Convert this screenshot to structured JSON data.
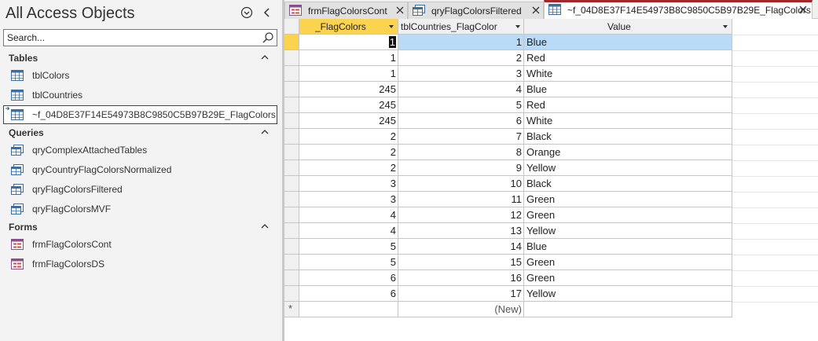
{
  "nav": {
    "title": "All Access Objects",
    "menu_icon": "circle-chevron-down-icon",
    "collapse_icon": "chevron-left-icon",
    "search_placeholder": "Search...",
    "groups": [
      {
        "label": "Tables",
        "items": [
          {
            "label": "tblColors",
            "icon": "table-icon"
          },
          {
            "label": "tblCountries",
            "icon": "table-icon"
          },
          {
            "label": "~f_04D8E37F14E54973B8C9850C5B97B29E_FlagColors",
            "icon": "linked-table-icon"
          }
        ]
      },
      {
        "label": "Queries",
        "items": [
          {
            "label": "qryComplexAttachedTables",
            "icon": "query-icon"
          },
          {
            "label": "qryCountryFlagColorsNormalized",
            "icon": "query-icon"
          },
          {
            "label": "qryFlagColorsFiltered",
            "icon": "query-icon"
          },
          {
            "label": "qryFlagColorsMVF",
            "icon": "query-icon"
          }
        ]
      },
      {
        "label": "Forms",
        "items": [
          {
            "label": "frmFlagColorsCont",
            "icon": "form-icon"
          },
          {
            "label": "frmFlagColorsDS",
            "icon": "form-icon"
          }
        ]
      }
    ]
  },
  "tabs": [
    {
      "label": "frmFlagColorsCont",
      "icon": "form-icon",
      "active": false
    },
    {
      "label": "qryFlagColorsFiltered",
      "icon": "query-icon",
      "active": false
    },
    {
      "label": "~f_04D8E37F14E54973B8C9850C5B97B29E_FlagColors",
      "icon": "table-icon",
      "active": true
    }
  ],
  "datasheet": {
    "columns": [
      "_FlagColors",
      "tblCountries_FlagColor",
      "Value"
    ],
    "rows": [
      {
        "flag": "1",
        "id": "1",
        "value": "Blue"
      },
      {
        "flag": "1",
        "id": "2",
        "value": "Red"
      },
      {
        "flag": "1",
        "id": "3",
        "value": "White"
      },
      {
        "flag": "245",
        "id": "4",
        "value": "Blue"
      },
      {
        "flag": "245",
        "id": "5",
        "value": "Red"
      },
      {
        "flag": "245",
        "id": "6",
        "value": "White"
      },
      {
        "flag": "2",
        "id": "7",
        "value": "Black"
      },
      {
        "flag": "2",
        "id": "8",
        "value": "Orange"
      },
      {
        "flag": "2",
        "id": "9",
        "value": "Yellow"
      },
      {
        "flag": "3",
        "id": "10",
        "value": "Black"
      },
      {
        "flag": "3",
        "id": "11",
        "value": "Green"
      },
      {
        "flag": "4",
        "id": "12",
        "value": "Green"
      },
      {
        "flag": "4",
        "id": "13",
        "value": "Yellow"
      },
      {
        "flag": "5",
        "id": "14",
        "value": "Blue"
      },
      {
        "flag": "5",
        "id": "15",
        "value": "Green"
      },
      {
        "flag": "6",
        "id": "16",
        "value": "Green"
      },
      {
        "flag": "6",
        "id": "17",
        "value": "Yellow"
      }
    ],
    "new_row_marker": "*",
    "new_row_label": "(New)"
  },
  "colors": {
    "accent_tab": "#a4262c",
    "selection_yellow": "#fcd34f",
    "selection_blue": "#b9dbf7"
  }
}
